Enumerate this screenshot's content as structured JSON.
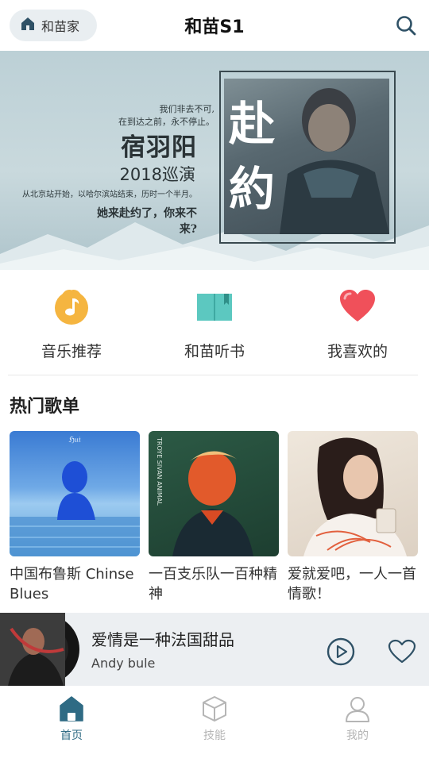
{
  "header": {
    "home_chip_label": "和苗家",
    "title": "和苗S1",
    "icons": {
      "home": "home-icon",
      "search": "search-icon"
    }
  },
  "banner": {
    "poem_line1": "我们非去不可,",
    "poem_line2": "在到达之前，永不停止。",
    "singer": "宿羽阳",
    "tour": "2018巡演",
    "route": "从北京站开始，以哈尔滨站结束，历时一个半月。",
    "invite": "她来赴约了，你来不来?",
    "photo_calligraphy": [
      "赴",
      "約"
    ]
  },
  "shortcuts": [
    {
      "label": "音乐推荐",
      "icon": "music-note-icon",
      "color": "#f5b540"
    },
    {
      "label": "和苗听书",
      "icon": "book-icon",
      "color": "#5cc8c0"
    },
    {
      "label": "我喜欢的",
      "icon": "heart-icon",
      "color": "#f0505a"
    }
  ],
  "hot_playlists": {
    "title": "热门歌单",
    "items": [
      {
        "name": "中国布鲁斯 Chinse Blues",
        "cover_text": "ℌ𝔲𝔦"
      },
      {
        "name": "一百支乐队一百种精神",
        "cover_text": "TROYE SIVAN ANIMAL"
      },
      {
        "name": "爱就爱吧，一人一首情歌！",
        "cover_text": ""
      }
    ]
  },
  "now_playing": {
    "song": "爱情是一种法国甜品",
    "artist": "Andy bule",
    "icons": {
      "play": "play-icon",
      "like": "heart-outline-icon"
    }
  },
  "tabbar": {
    "tabs": [
      {
        "label": "首页",
        "icon": "home-icon",
        "active": true
      },
      {
        "label": "技能",
        "icon": "cube-icon",
        "active": false
      },
      {
        "label": "我的",
        "icon": "person-icon",
        "active": false
      }
    ],
    "active_color": "#2f6b84",
    "inactive_color": "#b5b5b5"
  }
}
